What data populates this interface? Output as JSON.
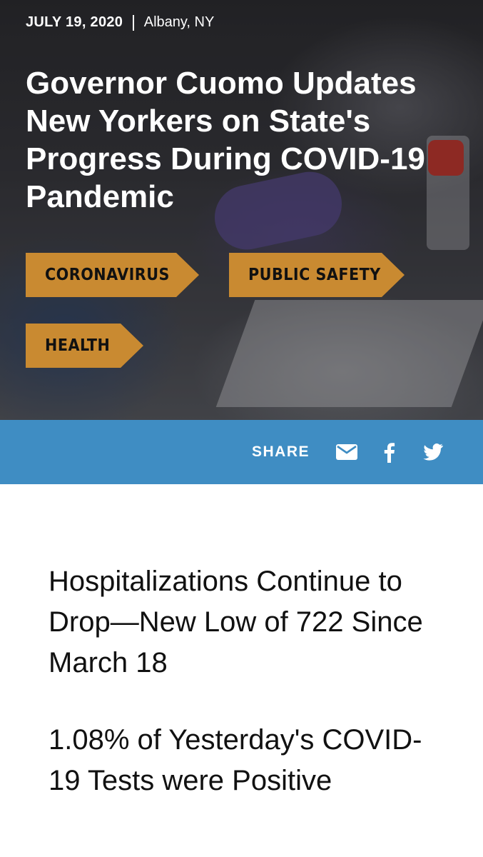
{
  "meta": {
    "date": "JULY 19, 2020",
    "location": "Albany, NY"
  },
  "headline": "Governor Cuomo Updates New Yorkers on State's Progress During COVID-19 Pandemic",
  "tags": [
    {
      "label": "CORONAVIRUS"
    },
    {
      "label": "PUBLIC SAFETY"
    },
    {
      "label": "HEALTH"
    }
  ],
  "share": {
    "label": "SHARE",
    "icons": [
      "envelope-icon",
      "facebook-icon",
      "twitter-icon"
    ]
  },
  "article": {
    "subheads": [
      "Hospitalizations Continue to Drop—New Low of 722 Since March 18",
      "1.08% of Yesterday's COVID-19 Tests were Positive"
    ]
  },
  "colors": {
    "tag_background": "#c98a31",
    "share_bar": "#3f8dc3",
    "text_light": "#ffffff",
    "text_dark": "#111111"
  }
}
